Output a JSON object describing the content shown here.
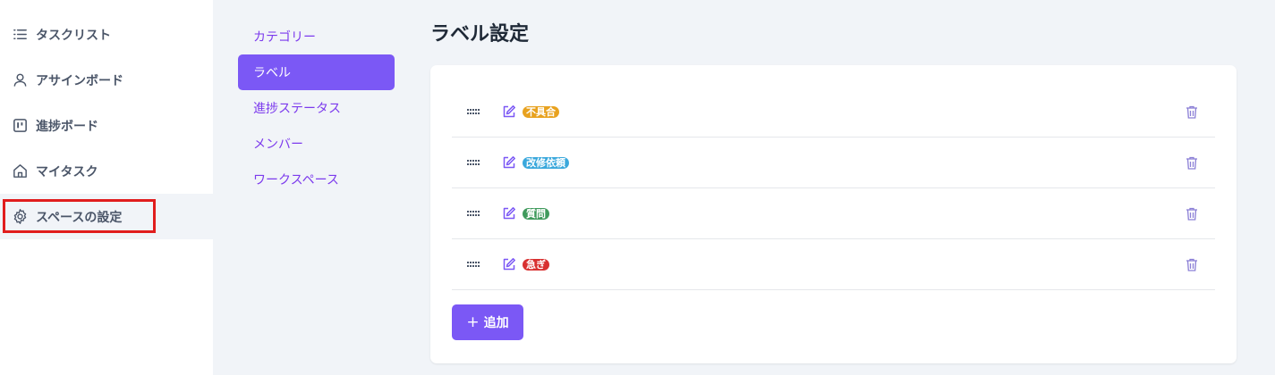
{
  "sidebar": {
    "items": [
      {
        "label": "タスクリスト",
        "icon": "list-icon"
      },
      {
        "label": "アサインボード",
        "icon": "user-icon"
      },
      {
        "label": "進捗ボード",
        "icon": "board-icon"
      },
      {
        "label": "マイタスク",
        "icon": "home-icon"
      },
      {
        "label": "スペースの設定",
        "icon": "gear-icon",
        "active": true
      }
    ]
  },
  "subnav": {
    "items": [
      {
        "label": "カテゴリー"
      },
      {
        "label": "ラベル",
        "active": true
      },
      {
        "label": "進捗ステータス"
      },
      {
        "label": "メンバー"
      },
      {
        "label": "ワークスペース"
      }
    ]
  },
  "main": {
    "title": "ラベル設定",
    "labels": [
      {
        "name": "不具合",
        "color": "#e8a21f"
      },
      {
        "name": "改修依頼",
        "color": "#3aa8dc"
      },
      {
        "name": "質問",
        "color": "#3f9a5c"
      },
      {
        "name": "急ぎ",
        "color": "#d83030"
      }
    ],
    "add_label": "追加",
    "add_plus": "+"
  },
  "colors": {
    "accent": "#7b58f5",
    "highlight": "#e11d1d"
  }
}
